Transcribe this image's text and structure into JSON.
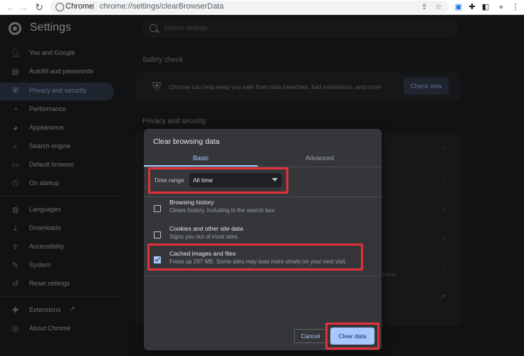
{
  "browser": {
    "omnibox_site": "Chrome",
    "omnibox_separator": "|",
    "omnibox_url": "chrome://settings/clearBrowserData"
  },
  "header": {
    "title": "Settings",
    "search_placeholder": "Search settings"
  },
  "sidebar": {
    "items": [
      {
        "label": "You and Google",
        "icon": "person-icon"
      },
      {
        "label": "Autofill and passwords",
        "icon": "clipboard-icon"
      },
      {
        "label": "Privacy and security",
        "icon": "shield-icon",
        "active": true
      },
      {
        "label": "Performance",
        "icon": "speedometer-icon"
      },
      {
        "label": "Appearance",
        "icon": "palette-icon"
      },
      {
        "label": "Search engine",
        "icon": "search-icon"
      },
      {
        "label": "Default browser",
        "icon": "browser-icon"
      },
      {
        "label": "On startup",
        "icon": "power-icon"
      },
      {
        "label": "Languages",
        "icon": "globe-icon"
      },
      {
        "label": "Downloads",
        "icon": "download-icon"
      },
      {
        "label": "Accessibility",
        "icon": "accessibility-icon"
      },
      {
        "label": "System",
        "icon": "wrench-icon"
      },
      {
        "label": "Reset settings",
        "icon": "history-icon"
      },
      {
        "label": "Extensions",
        "icon": "puzzle-icon"
      },
      {
        "label": "About Chrome",
        "icon": "chrome-icon"
      }
    ]
  },
  "main": {
    "safety_check_title": "Safety check",
    "safety_check_text": "Chrome can help keep you safe from data breaches, bad extensions, and more",
    "check_now_label": "Check now",
    "privacy_title": "Privacy and security",
    "partial_row_text": "nd more)"
  },
  "dialog": {
    "title": "Clear browsing data",
    "tabs": {
      "basic": "Basic",
      "advanced": "Advanced"
    },
    "time_range_label": "Time range",
    "time_range_value": "All time",
    "options": [
      {
        "title": "Browsing history",
        "desc": "Clears history, including in the search box",
        "checked": false
      },
      {
        "title": "Cookies and other site data",
        "desc": "Signs you out of most sites.",
        "checked": false
      },
      {
        "title": "Cached images and files",
        "desc": "Frees up 297 MB. Some sites may load more slowly on your next visit.",
        "checked": true
      }
    ],
    "cancel_label": "Cancel",
    "clear_label": "Clear data"
  },
  "colors": {
    "accent": "#a8c7fa",
    "highlight_box": "#e3303b",
    "background": "#202124",
    "dialog_bg": "#35363a"
  }
}
